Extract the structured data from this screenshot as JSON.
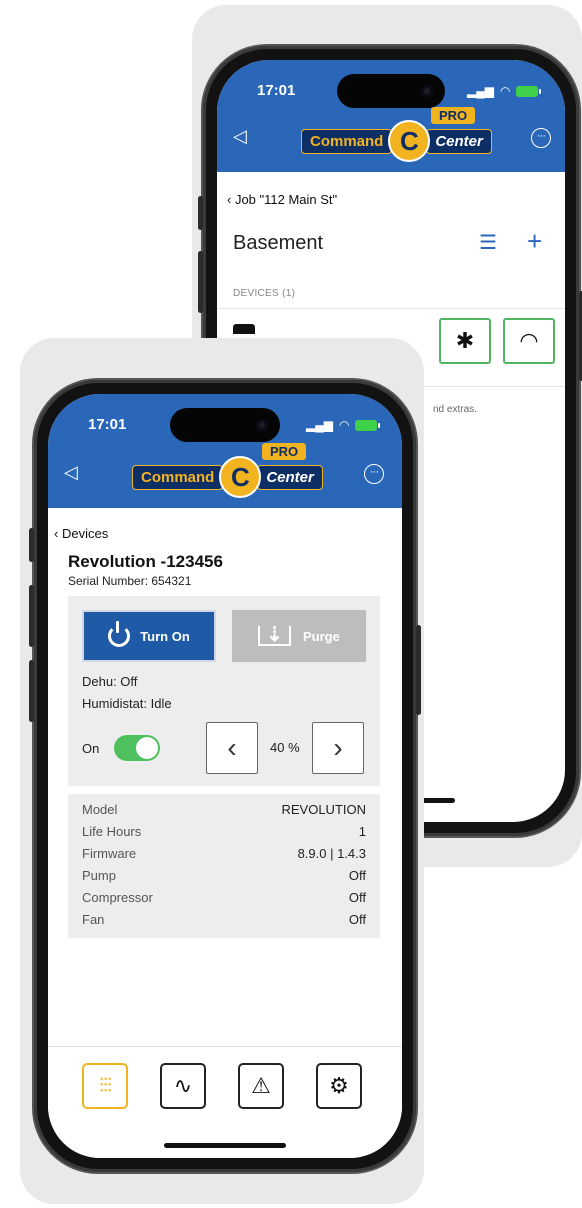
{
  "back_phone": {
    "status": {
      "time": "17:01"
    },
    "header": {
      "logo_word1": "Command",
      "logo_c": "C",
      "logo_word2": "Center",
      "logo_badge": "PRO"
    },
    "breadcrumb": "Job \"112 Main St\"",
    "page_title": "Basement",
    "section_label": "DEVICES (1)",
    "partial_text": "nd extras."
  },
  "front_phone": {
    "status": {
      "time": "17:01"
    },
    "header": {
      "logo_word1": "Command",
      "logo_c": "C",
      "logo_word2": "Center",
      "logo_badge": "PRO"
    },
    "breadcrumb": "Devices",
    "device": {
      "title": "Revolution -123456",
      "serial": "Serial Number: 654321"
    },
    "controls": {
      "turn_on_label": "Turn On",
      "purge_label": "Purge",
      "dehu_status": "Dehu: Off",
      "humidistat_status": "Humidistat: Idle",
      "toggle_label": "On",
      "toggle_on": true,
      "setpoint": "40 %"
    },
    "info": [
      {
        "label": "Model",
        "value": "REVOLUTION"
      },
      {
        "label": "Life Hours",
        "value": "1"
      },
      {
        "label": "Firmware",
        "value": "8.9.0 | 1.4.3"
      },
      {
        "label": "Pump",
        "value": "Off"
      },
      {
        "label": "Compressor",
        "value": "Off"
      },
      {
        "label": "Fan",
        "value": "Off"
      }
    ],
    "tabs": [
      {
        "name": "controls-icon",
        "active": true
      },
      {
        "name": "chart-icon",
        "active": false
      },
      {
        "name": "alert-icon",
        "active": false
      },
      {
        "name": "settings-icon",
        "active": false
      }
    ]
  },
  "colors": {
    "brand_blue": "#2b67b8",
    "logo_gold": "#f2b321",
    "toggle_green": "#4ec05d",
    "connect_green": "#4fb561"
  }
}
